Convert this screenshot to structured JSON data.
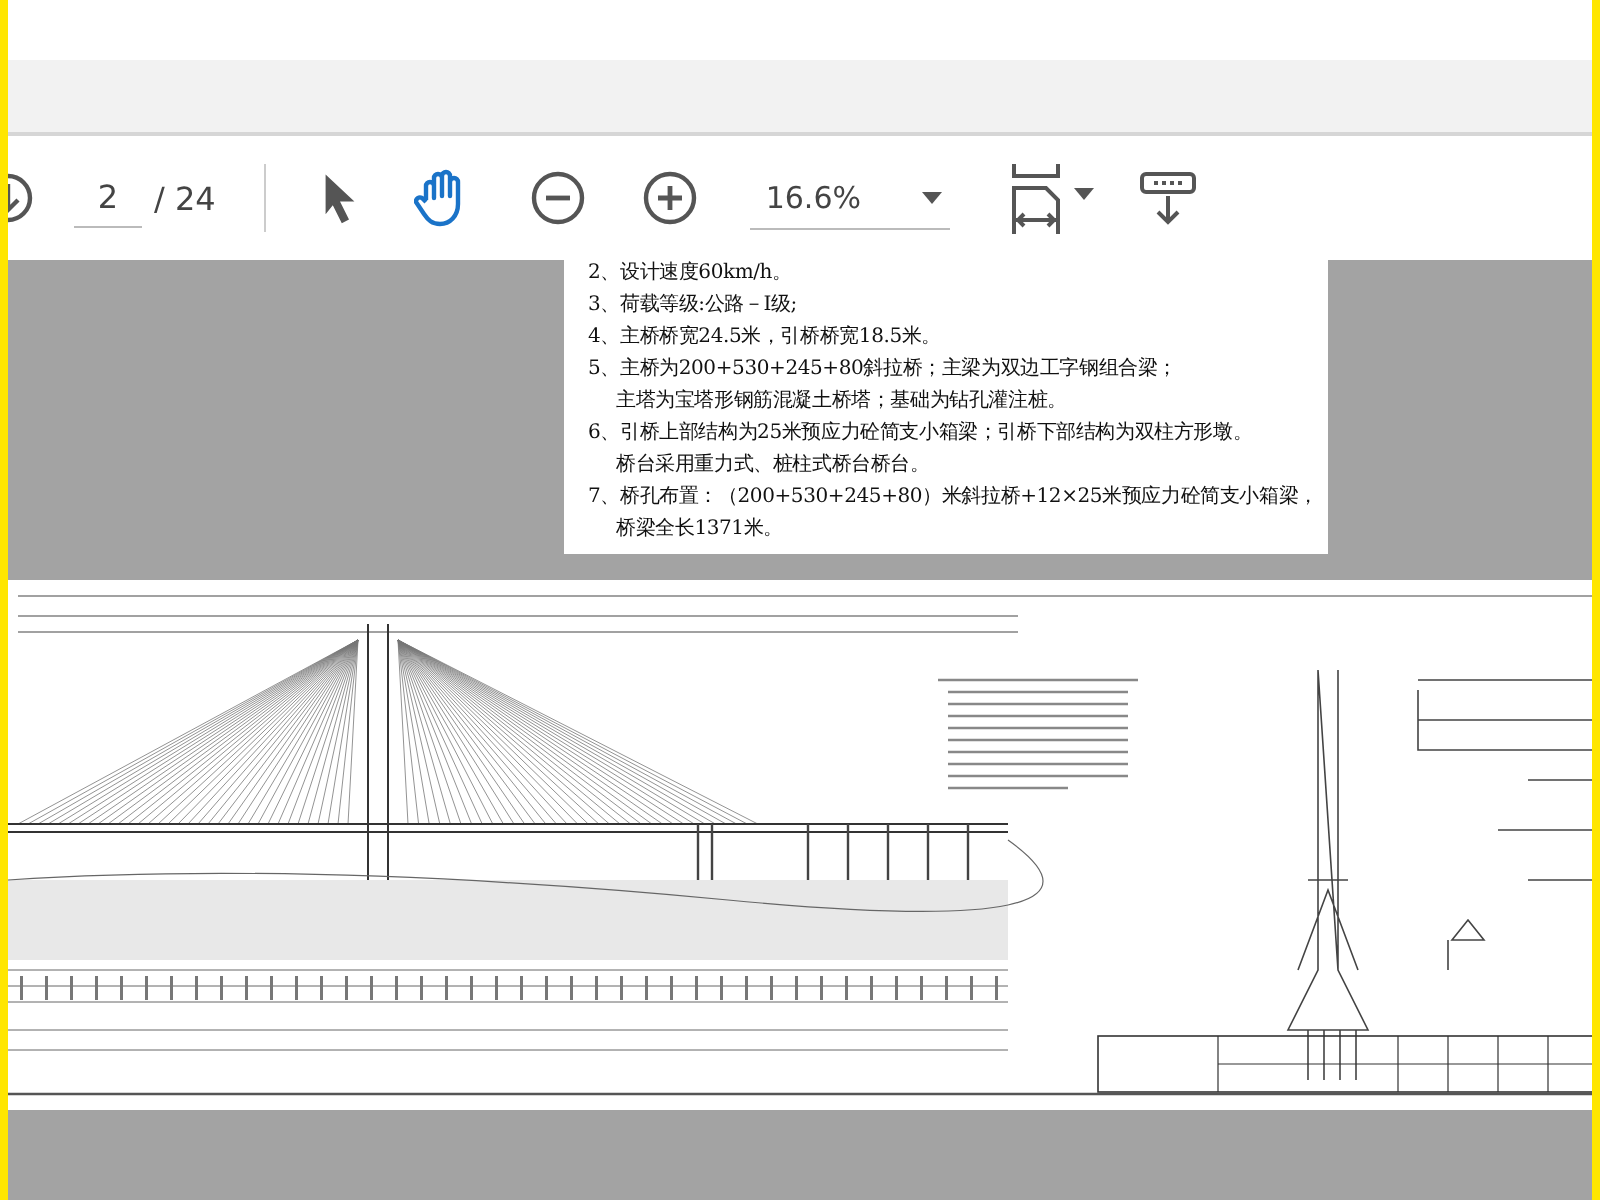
{
  "toolbar": {
    "page_field": {
      "value": "2"
    },
    "page_total": "/ 24",
    "tools": [
      {
        "kind": "select",
        "selected": false
      },
      {
        "kind": "hand",
        "selected": true
      }
    ],
    "zoom_field": {
      "value": "16.6%"
    }
  },
  "notes": [
    {
      "lines": [
        "2、设计速度60km/h。"
      ]
    },
    {
      "lines": [
        "3、荷载等级:公路－Ⅰ级;"
      ]
    },
    {
      "lines": [
        "4、主桥桥宽24.5米，引桥桥宽18.5米。"
      ]
    },
    {
      "lines": [
        "5、主桥为200+530+245+80斜拉桥；主梁为双边工字钢组合梁；",
        "主塔为宝塔形钢筋混凝土桥塔；基础为钻孔灌注桩。"
      ]
    },
    {
      "lines": [
        "6、引桥上部结构为25米预应力砼简支小箱梁；引桥下部结构为双柱方形墩。",
        "桥台采用重力式、桩柱式桥台桥台。"
      ]
    },
    {
      "lines": [
        "7、桥孔布置：（200+530+245+80）米斜拉桥+12×25米预应力砼简支小箱梁，",
        "桥梁全长1371米。"
      ]
    }
  ]
}
